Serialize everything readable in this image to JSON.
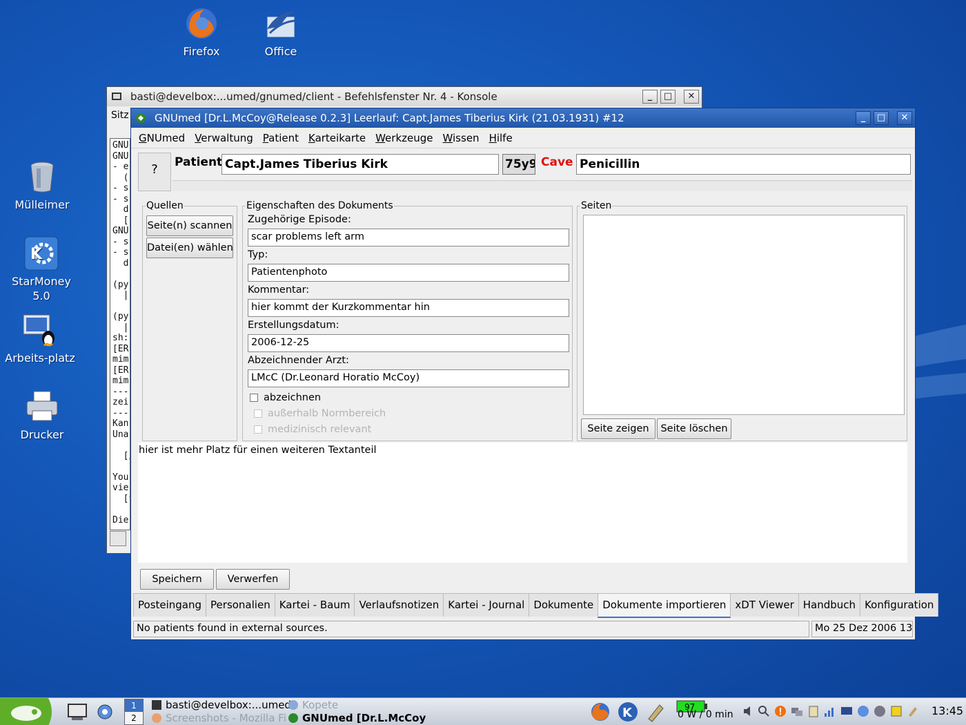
{
  "desktop": {
    "icons": [
      {
        "label": "Firefox"
      },
      {
        "label": "Office"
      },
      {
        "label": "Mülleimer"
      },
      {
        "label": "StarMoney 5.0"
      },
      {
        "label": "Arbeits-platz"
      },
      {
        "label": "Drucker"
      }
    ]
  },
  "konsole": {
    "title": "basti@develbox:...umed/gnumed/client - Befehlsfenster Nr. 4 - Konsole",
    "menu_first": "Sitz",
    "lines": [
      "GNU",
      "GNU",
      "- e",
      "  (",
      "- s",
      "- s",
      "  d",
      "  [",
      "GNU",
      "- s",
      "- s",
      "  d",
      "",
      "(py",
      "  ||",
      "",
      "(py",
      "  ||",
      "sh:",
      "[ER",
      "mim",
      "[ER",
      "mim",
      "---",
      "zei",
      "---",
      "Kan",
      "Una",
      "",
      "  [/",
      "",
      "You",
      "vie",
      "  [t",
      "",
      "Die"
    ]
  },
  "gnumed": {
    "title": "GNUmed [Dr.L.McCoy@Release 0.2.3] Leerlauf: Capt.James Tiberius Kirk (21.03.1931) #12",
    "menu": [
      {
        "pre": "",
        "u": "G",
        "post": "NUmed"
      },
      {
        "pre": "",
        "u": "V",
        "post": "erwaltung"
      },
      {
        "pre": "",
        "u": "P",
        "post": "atient"
      },
      {
        "pre": "",
        "u": "K",
        "post": "arteikarte"
      },
      {
        "pre": "",
        "u": "W",
        "post": "erkzeuge"
      },
      {
        "pre": "",
        "u": "W",
        "post": "issen"
      },
      {
        "pre": "",
        "u": "H",
        "post": "ilfe"
      }
    ],
    "patient": {
      "photo_placeholder": "?",
      "label": "Patient",
      "name": "Capt.James Tiberius Kirk",
      "age": "75y9",
      "cave_label": "Cave",
      "allergy": "Penicillin"
    },
    "sources": {
      "legend": "Quellen",
      "scan_button": "Seite(n) scannen",
      "files_button": "Datei(en) wählen"
    },
    "properties": {
      "legend": "Eigenschaften des Dokuments",
      "episode_label": "Zugehörige Episode:",
      "episode_value": "scar problems left arm",
      "type_label": "Typ:",
      "type_value": "Patientenphoto",
      "comment_label": "Kommentar:",
      "comment_value": "hier kommt der Kurzkommentar hin",
      "date_label": "Erstellungsdatum:",
      "date_value": "2006-12-25",
      "doctor_label": "Abzeichnender Arzt:",
      "doctor_value": "LMcC (Dr.Leonard Horatio McCoy)",
      "sign_checkbox": "abzeichnen",
      "abnormal_checkbox": "außerhalb Normbereich",
      "relevant_checkbox": "medizinisch relevant"
    },
    "pages": {
      "legend": "Seiten",
      "show_button": "Seite zeigen",
      "delete_button": "Seite löschen"
    },
    "free_text": "hier ist mehr Platz für einen weiteren Textanteil",
    "save_button": "Speichern",
    "discard_button": "Verwerfen",
    "tabs": [
      {
        "label": "Posteingang",
        "active": false
      },
      {
        "label": "Personalien",
        "active": false
      },
      {
        "label": "Kartei - Baum",
        "active": false
      },
      {
        "label": "Verlaufsnotizen",
        "active": false
      },
      {
        "label": "Kartei - Journal",
        "active": false
      },
      {
        "label": "Dokumente",
        "active": false
      },
      {
        "label": "Dokumente importieren",
        "active": true
      },
      {
        "label": "xDT Viewer",
        "active": false
      },
      {
        "label": "Handbuch",
        "active": false
      },
      {
        "label": "Konfiguration",
        "active": false
      }
    ],
    "status_message": "No patients found in external sources.",
    "status_time": "Mo 25 Dez 2006 13:"
  },
  "taskbar": {
    "pager_current": "1",
    "pager_other": "2",
    "tasks": [
      {
        "label": "basti@develbox:...umed/"
      },
      {
        "label": "Kopete"
      },
      {
        "label": "Screenshots - Mozilla Fi"
      },
      {
        "label": "GNUmed [Dr.L.McCoy"
      }
    ],
    "battery_percent": "97",
    "battery_status": "0 W / 0 min",
    "clock": "13:45"
  },
  "colors": {
    "desktop_blue": "#1457b8",
    "title_active": "#2a62b8",
    "cave_red": "#e01010",
    "battery_green": "#22dd22"
  }
}
